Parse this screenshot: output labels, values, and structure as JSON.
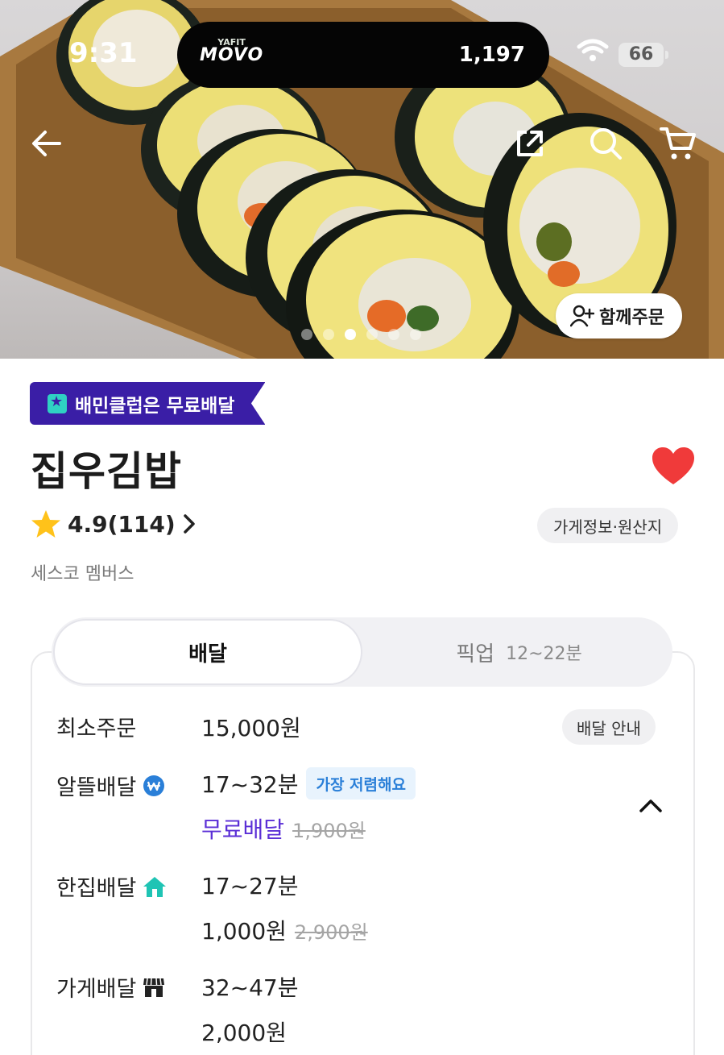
{
  "status_bar": {
    "time": "9:31",
    "app_small": "YAFIT",
    "app_big": "MOVO",
    "steps": "1,197",
    "battery": "66"
  },
  "hero": {
    "carousel_count": 6,
    "active_index": 2,
    "group_order_label": "함께주문"
  },
  "store": {
    "club_badge": "배민클럽은 무료배달",
    "name": "집우김밥",
    "rating": "4.9(114)",
    "info_chip": "가게정보·원산지",
    "member": "세스코 멤버스"
  },
  "tabs": {
    "delivery": "배달",
    "pickup": "픽업",
    "pickup_time": "12~22분"
  },
  "delivery": {
    "min_order_label": "최소주문",
    "min_order_value": "15,000원",
    "guide_label": "배달 안내",
    "saver": {
      "label": "알뜰배달",
      "time": "17~32분",
      "badge": "가장 저렴해요",
      "fee": "무료배달",
      "original": "1,900원"
    },
    "single": {
      "label": "한집배달",
      "time": "17~27분",
      "fee": "1,000원",
      "original": "2,900원"
    },
    "store_delivery": {
      "label": "가게배달",
      "time": "32~47분",
      "fee": "2,000원"
    }
  },
  "colors": {
    "brand_purple": "#3a1ea6",
    "accent_teal": "#2fd1c3",
    "heart": "#f03a3a",
    "free_delivery": "#5b2fd6",
    "badge_blue": "#2a7fd8"
  }
}
